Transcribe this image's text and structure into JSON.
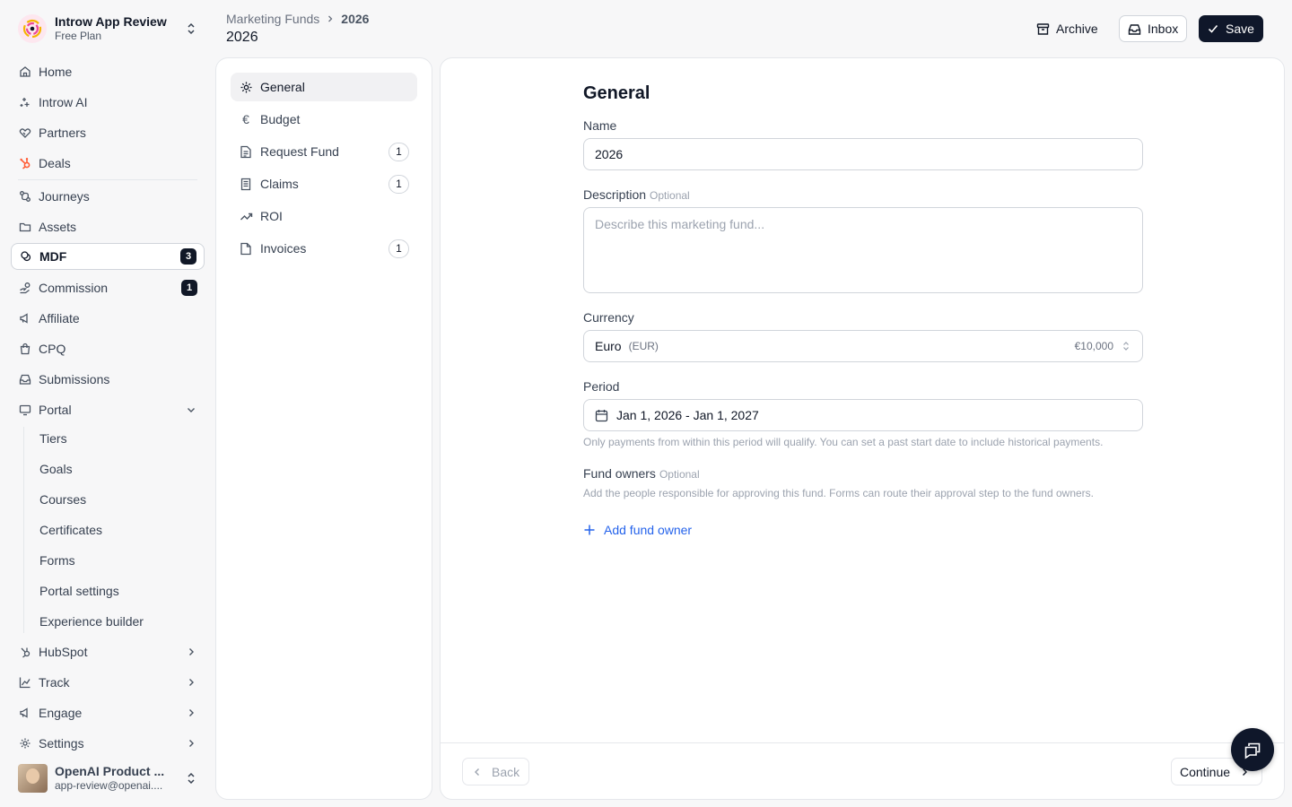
{
  "workspace": {
    "name": "Introw App Review",
    "plan": "Free Plan"
  },
  "nav": {
    "home": "Home",
    "introw_ai": "Introw AI",
    "partners": "Partners",
    "deals": "Deals",
    "journeys": "Journeys",
    "assets": "Assets",
    "mdf": "MDF",
    "mdf_badge": "3",
    "commission": "Commission",
    "commission_badge": "1",
    "affiliate": "Affiliate",
    "cpq": "CPQ",
    "submissions": "Submissions",
    "portal": "Portal",
    "portal_sub": [
      "Tiers",
      "Goals",
      "Courses",
      "Certificates",
      "Forms",
      "Portal settings",
      "Experience builder"
    ],
    "hubspot": "HubSpot",
    "track": "Track",
    "engage": "Engage",
    "settings": "Settings"
  },
  "user": {
    "name": "OpenAI Product ...",
    "email": "app-review@openai...."
  },
  "header": {
    "breadcrumb_parent": "Marketing Funds",
    "breadcrumb_current": "2026",
    "title": "2026",
    "archive_label": "Archive",
    "inbox_label": "Inbox",
    "save_label": "Save"
  },
  "subnav": {
    "general": "General",
    "budget": "Budget",
    "request_fund": "Request Fund",
    "request_fund_count": "1",
    "claims": "Claims",
    "claims_count": "1",
    "roi": "ROI",
    "invoices": "Invoices",
    "invoices_count": "1"
  },
  "form": {
    "title": "General",
    "name_label": "Name",
    "name_value": "2026",
    "description_label": "Description",
    "optional": "Optional",
    "description_placeholder": "Describe this marketing fund...",
    "currency_label": "Currency",
    "currency_name": "Euro",
    "currency_code": "(EUR)",
    "currency_amount": "€10,000",
    "period_label": "Period",
    "period_value": "Jan 1, 2026 - Jan 1, 2027",
    "period_help": "Only payments from within this period will qualify. You can set a past start date to include historical payments.",
    "owners_label": "Fund owners",
    "owners_help": "Add the people responsible for approving this fund. Forms can route their approval step to the fund owners.",
    "add_owner": "Add fund owner"
  },
  "footer": {
    "back": "Back",
    "continue": "Continue"
  },
  "colors": {
    "primary": "#0f172a",
    "link": "#2563eb",
    "hubspot": "#ff5c35"
  }
}
